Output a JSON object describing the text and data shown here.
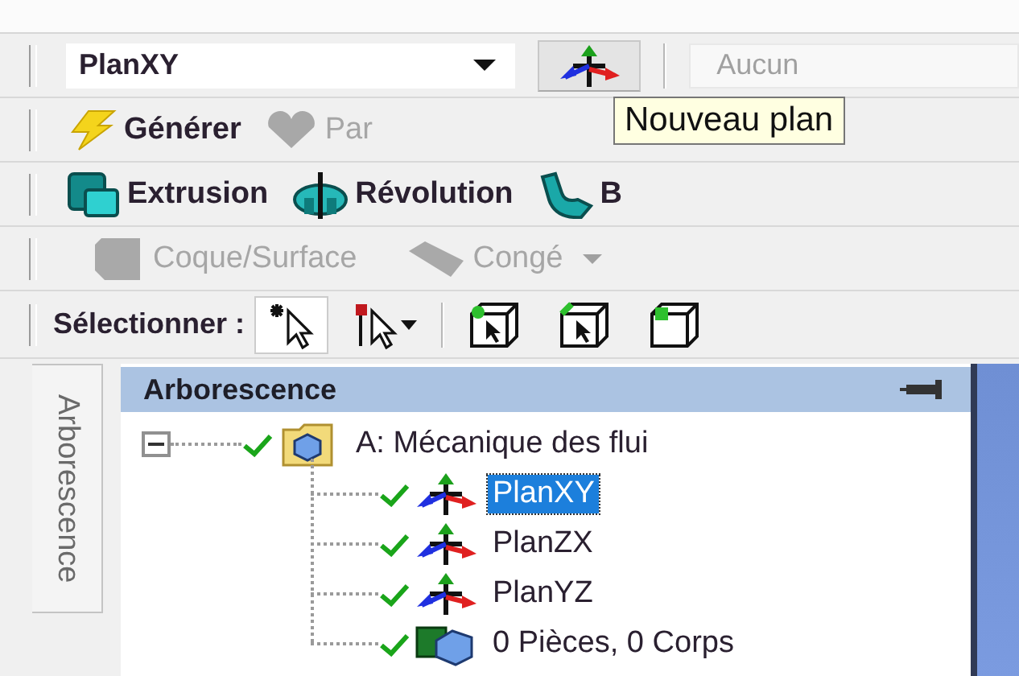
{
  "plane_toolbar": {
    "plane_select": {
      "value": "PlanXY"
    },
    "new_plane_button": {
      "pressed": true
    },
    "sketch_select": {
      "placeholder": "Aucun"
    }
  },
  "tooltip": {
    "text": "Nouveau plan"
  },
  "feature_toolbar": [
    {
      "kind": "generate",
      "label": "Générer",
      "disabled": false
    },
    {
      "kind": "part",
      "label": "Par",
      "disabled": true
    }
  ],
  "create_toolbar": [
    {
      "kind": "extrude",
      "label": "Extrusion",
      "disabled": false
    },
    {
      "kind": "revolve",
      "label": "Révolution",
      "disabled": false
    },
    {
      "kind": "sweep",
      "label": "B",
      "disabled": false
    }
  ],
  "ops_toolbar": [
    {
      "kind": "shell",
      "label": "Coque/Surface",
      "disabled": true,
      "dropdown": false
    },
    {
      "kind": "blend",
      "label": "Congé",
      "disabled": true,
      "dropdown": true
    }
  ],
  "selection_toolbar": {
    "label": "Sélectionner :",
    "buttons": [
      {
        "kind": "single",
        "selected": true
      },
      {
        "kind": "box",
        "selected": false
      },
      {
        "kind": "vertex",
        "selected": false
      },
      {
        "kind": "edge",
        "selected": false
      },
      {
        "kind": "face",
        "selected": false
      }
    ]
  },
  "side_tab": {
    "label": "Arborescence"
  },
  "tree": {
    "title": "Arborescence",
    "items": [
      {
        "kind": "model",
        "label": "A: Mécanique des flui",
        "expanded": true,
        "selected": false,
        "children": [
          {
            "kind": "plane",
            "label": "PlanXY",
            "selected": true
          },
          {
            "kind": "plane",
            "label": "PlanZX",
            "selected": false
          },
          {
            "kind": "plane",
            "label": "PlanYZ",
            "selected": false
          },
          {
            "kind": "bodies",
            "label": "0 Pièces, 0 Corps",
            "selected": false
          }
        ]
      }
    ]
  }
}
